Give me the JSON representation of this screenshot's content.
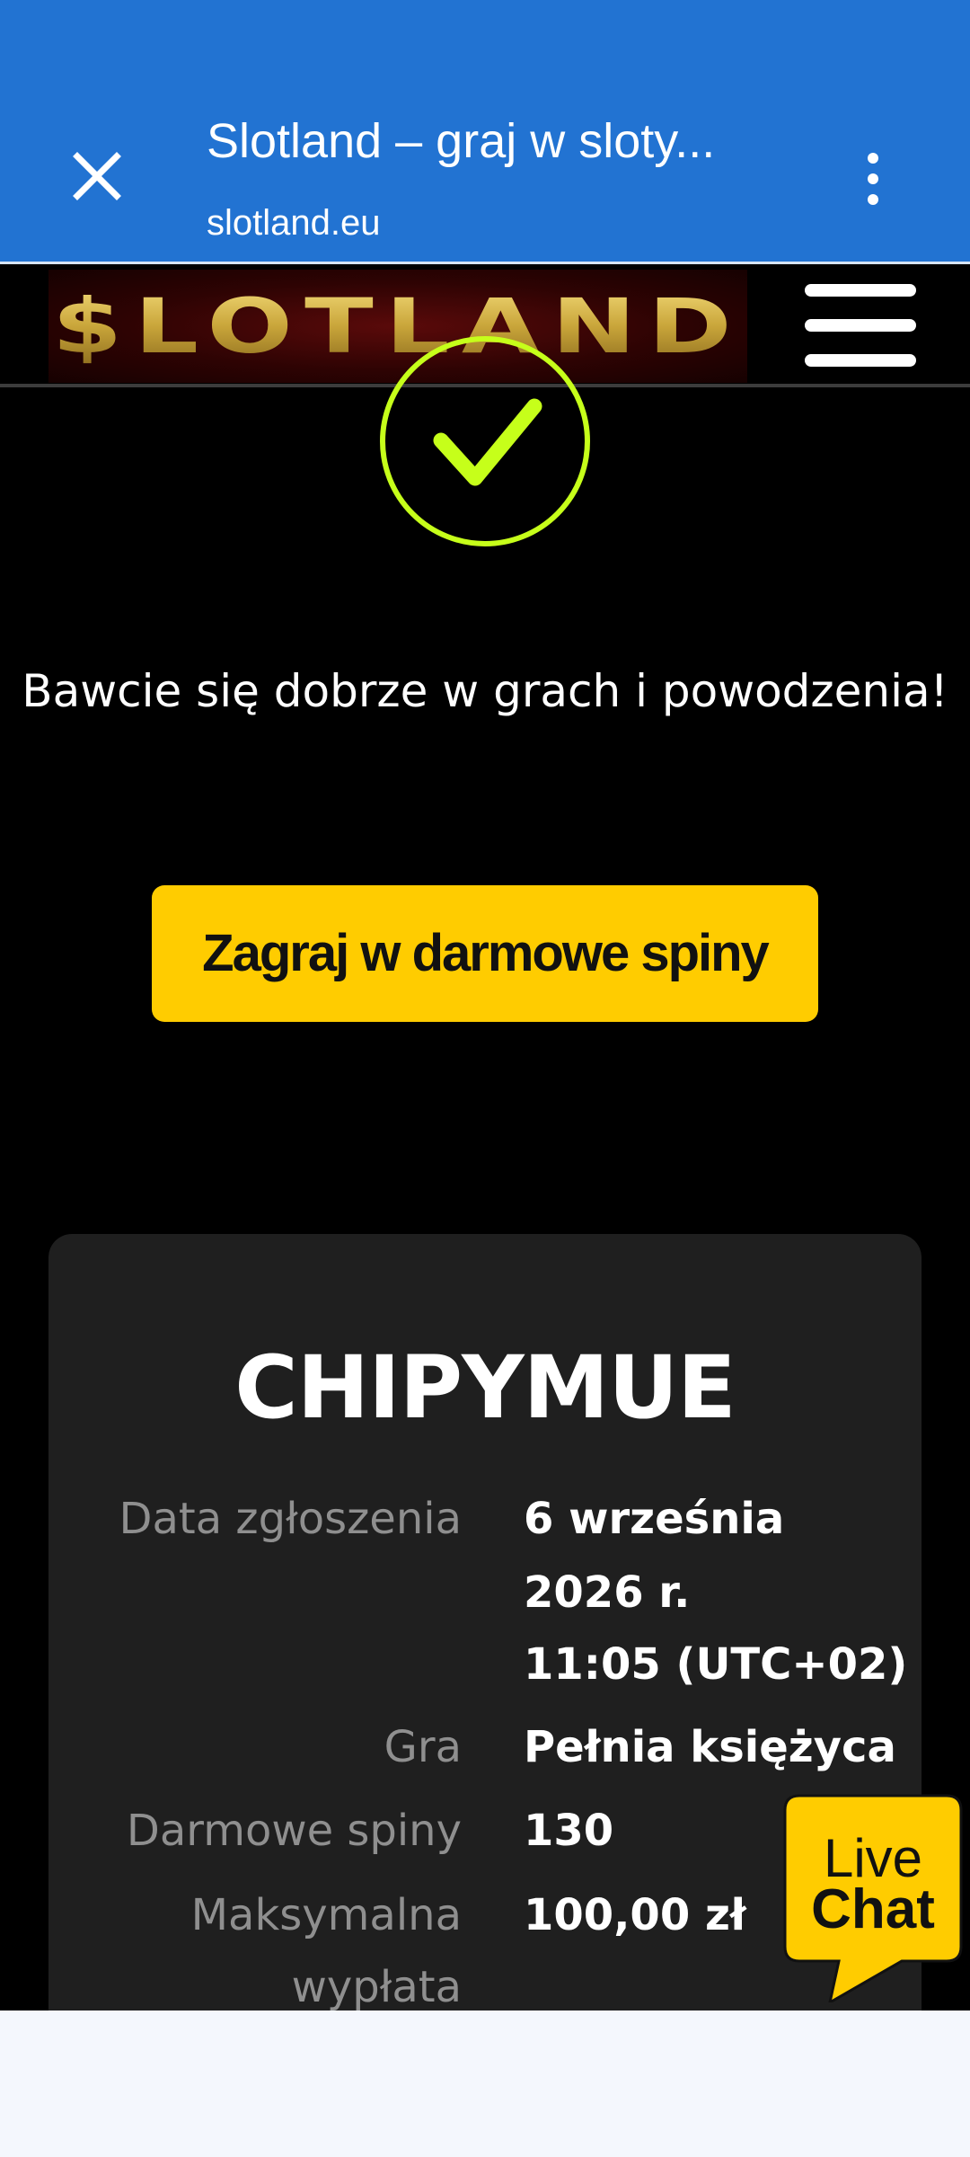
{
  "browser": {
    "title": "Slotland – graj w sloty...",
    "url": "slotland.eu"
  },
  "site": {
    "logo_text": "$LOTLAND"
  },
  "message": "Bawcie się dobrze w grach i powodzenia!",
  "cta_label": "Zagraj w darmowe spiny",
  "card": {
    "code": "CHIPYMUE",
    "rows": [
      {
        "label": "Data zgłoszenia",
        "value_lines": [
          "6 września",
          "2026 r.",
          "11:05 (UTC+02)"
        ]
      },
      {
        "label": "Gra",
        "value": "Pełnia księżyca"
      },
      {
        "label": "Darmowe spiny",
        "value": "130"
      },
      {
        "label_lines": [
          "Maksymalna",
          "wypłata"
        ],
        "value": "100,00 zł"
      }
    ]
  },
  "livechat": {
    "line1": "Live",
    "line2": "Chat"
  },
  "colors": {
    "browser_bar": "#2273d2",
    "cta": "#ffcc00",
    "check": "#c6ff1a",
    "card_bg": "#1f1f1f",
    "livechat": "#ffcc00"
  },
  "icons": [
    "close-icon",
    "more-vert-icon",
    "hamburger-menu-icon",
    "checkmark-icon",
    "chat-bubble-icon"
  ]
}
